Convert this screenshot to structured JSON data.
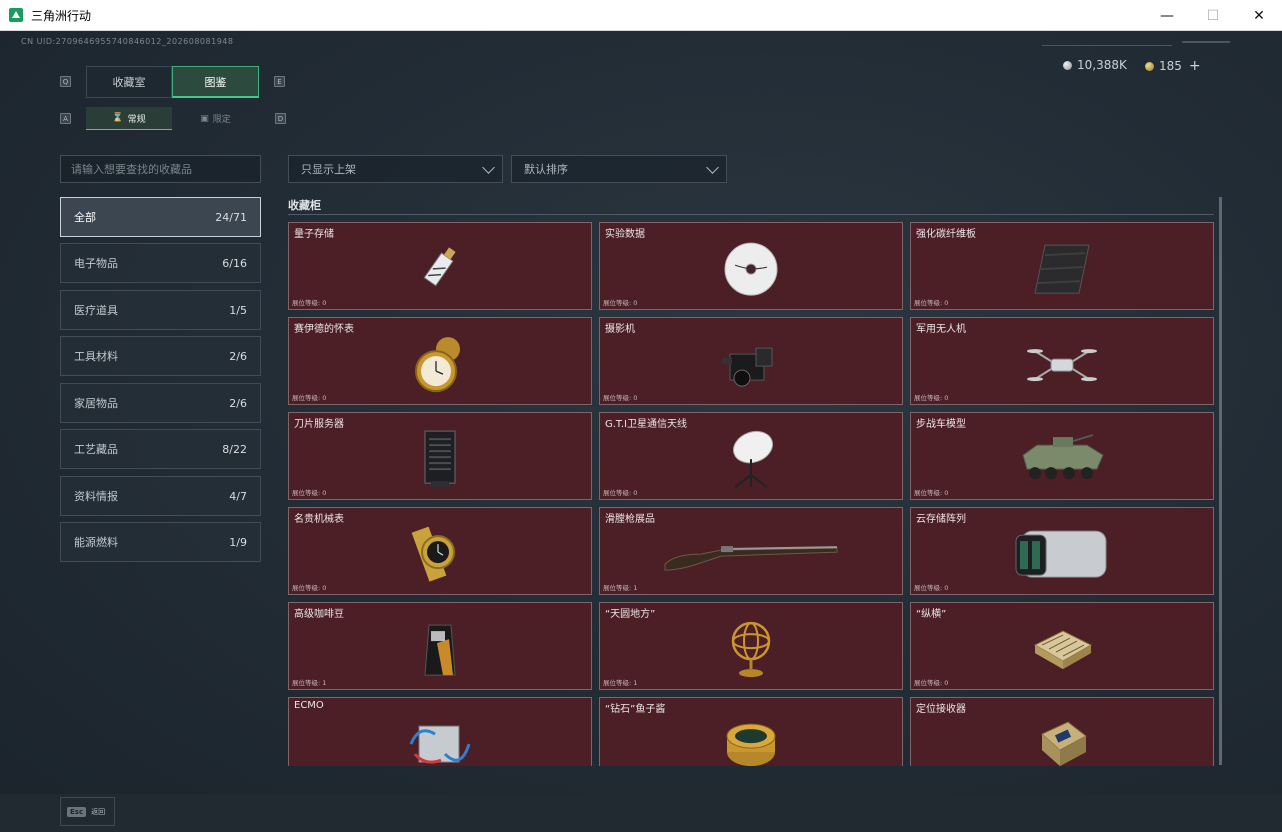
{
  "window": {
    "title": "三角洲行动",
    "min": "—",
    "max": "☐",
    "close": "✕"
  },
  "uid": "CN UID:2709646955740846012_202608081948",
  "currency": {
    "silver": "10,388K",
    "gold": "185",
    "plus": "+"
  },
  "tabs": {
    "key_left": "Q",
    "key_right": "E",
    "main": [
      {
        "label": "收藏室"
      },
      {
        "label": "图鉴"
      }
    ],
    "sub_key_left": "A",
    "sub_key_right": "D",
    "sub": [
      {
        "label": "常规",
        "icon": "hourglass-icon"
      },
      {
        "label": "限定",
        "icon": "frame-icon"
      }
    ]
  },
  "search": {
    "placeholder": "请输入想要查找的收藏品"
  },
  "categories": [
    {
      "label": "全部",
      "count": "24/71"
    },
    {
      "label": "电子物品",
      "count": "6/16"
    },
    {
      "label": "医疗道具",
      "count": "1/5"
    },
    {
      "label": "工具材料",
      "count": "2/6"
    },
    {
      "label": "家居物品",
      "count": "2/6"
    },
    {
      "label": "工艺藏品",
      "count": "8/22"
    },
    {
      "label": "资料情报",
      "count": "4/7"
    },
    {
      "label": "能源燃料",
      "count": "1/9"
    }
  ],
  "filters": {
    "shelf": "只显示上架",
    "sort": "默认排序"
  },
  "section_title": "收藏柜",
  "items": [
    {
      "name": "量子存储",
      "level": "展位等级: 0",
      "icon": "usb-drive-icon"
    },
    {
      "name": "实验数据",
      "level": "展位等级: 0",
      "icon": "disc-icon"
    },
    {
      "name": "强化碳纤维板",
      "level": "展位等级: 0",
      "icon": "carbon-plate-icon"
    },
    {
      "name": "赛伊德的怀表",
      "level": "展位等级: 0",
      "icon": "pocket-watch-icon"
    },
    {
      "name": "摄影机",
      "level": "展位等级: 0",
      "icon": "camera-icon"
    },
    {
      "name": "军用无人机",
      "level": "展位等级: 0",
      "icon": "drone-icon"
    },
    {
      "name": "刀片服务器",
      "level": "展位等级: 0",
      "icon": "server-icon"
    },
    {
      "name": "G.T.I卫星通信天线",
      "level": "展位等级: 0",
      "icon": "satellite-dish-icon"
    },
    {
      "name": "步战车模型",
      "level": "展位等级: 0",
      "icon": "armored-vehicle-icon"
    },
    {
      "name": "名贵机械表",
      "level": "展位等级: 0",
      "icon": "wristwatch-icon"
    },
    {
      "name": "滑膛枪展品",
      "level": "展位等级: 1",
      "icon": "musket-icon"
    },
    {
      "name": "云存储阵列",
      "level": "展位等级: 0",
      "icon": "storage-array-icon"
    },
    {
      "name": "高级咖啡豆",
      "level": "展位等级: 1",
      "icon": "coffee-bag-icon"
    },
    {
      "name": "“天圆地方”",
      "level": "展位等级: 1",
      "icon": "armillary-sphere-icon"
    },
    {
      "name": "“纵横”",
      "level": "展位等级: 0",
      "icon": "chessboard-icon"
    },
    {
      "name": "ECMO",
      "level": "",
      "icon": "ecmo-machine-icon"
    },
    {
      "name": "“钻石”鱼子酱",
      "level": "",
      "icon": "caviar-tin-icon"
    },
    {
      "name": "定位接收器",
      "level": "",
      "icon": "gps-receiver-icon"
    }
  ],
  "footer": {
    "esc_key": "Esc",
    "esc_label": "返回"
  },
  "colors": {
    "accent": "#48c88b",
    "card_bg": "#4b1f25",
    "card_border": "#7f646a"
  }
}
